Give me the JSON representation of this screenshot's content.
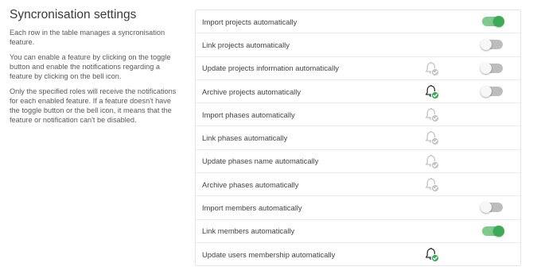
{
  "title": "Syncronisation settings",
  "paragraphs": [
    "Each row in the table manages a syncronisation feature.",
    "You can enable a feature by clicking on the toggle button and enable the notifications regarding a feature by clicking on the bell icon.",
    "Only the specified roles will receive the notifications for each enabled feature. If a feature doesn't have the toggle button or the bell icon, it means that the feature or notification can't be disabled."
  ],
  "colors": {
    "toggle_on": "#3ea957",
    "toggle_off": "#bdbdbd",
    "bell_active": "#333333",
    "bell_inactive": "#c4c4c4",
    "check_active": "#3ea957",
    "check_inactive": "#c4c4c4"
  },
  "rows": [
    {
      "label": "Import projects automatically",
      "bell": "none",
      "toggle": "on"
    },
    {
      "label": "Link projects automatically",
      "bell": "none",
      "toggle": "off"
    },
    {
      "label": "Update projects information automatically",
      "bell": "inactive",
      "toggle": "off"
    },
    {
      "label": "Archive projects automatically",
      "bell": "active",
      "toggle": "off"
    },
    {
      "label": "Import phases automatically",
      "bell": "inactive",
      "toggle": "none"
    },
    {
      "label": "Link phases automatically",
      "bell": "inactive",
      "toggle": "none"
    },
    {
      "label": "Update phases name automatically",
      "bell": "inactive",
      "toggle": "none"
    },
    {
      "label": "Archive phases automatically",
      "bell": "inactive",
      "toggle": "none"
    },
    {
      "label": "Import members automatically",
      "bell": "none",
      "toggle": "off"
    },
    {
      "label": "Link members automatically",
      "bell": "none",
      "toggle": "on"
    },
    {
      "label": "Update users membership automatically",
      "bell": "active",
      "toggle": "none"
    }
  ]
}
